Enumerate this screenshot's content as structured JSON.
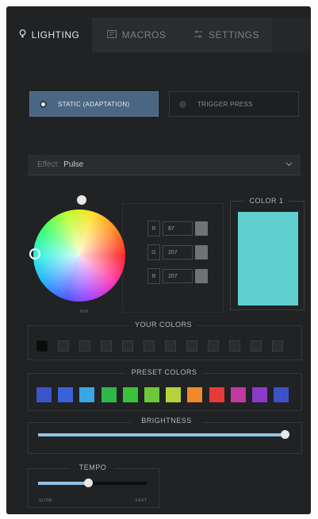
{
  "tabs": [
    {
      "label": "LIGHTING",
      "icon": "lightbulb-icon",
      "active": true
    },
    {
      "label": "MACROS",
      "icon": "macro-icon",
      "active": false
    },
    {
      "label": "SETTINGS",
      "icon": "settings-icon",
      "active": false
    }
  ],
  "mode": {
    "static_label": "STATIC (ADAPTATION)",
    "trigger_label": "TRIGGER PRESS",
    "selected": "static"
  },
  "effect": {
    "label": "Effect:",
    "value": "Pulse"
  },
  "wheel": {
    "caption": "HUE"
  },
  "rgb": [
    {
      "key": "R",
      "value": "87"
    },
    {
      "key": "G",
      "value": "207"
    },
    {
      "key": "B",
      "value": "207"
    }
  ],
  "color1": {
    "title": "COLOR 1",
    "swatch_color": "#5fcfcf"
  },
  "your_colors": {
    "title": "YOUR COLORS",
    "slots": 12,
    "filled_slots": 1
  },
  "preset_colors": {
    "title": "PRESET COLORS",
    "colors": [
      "#3a55c8",
      "#3a62d8",
      "#3aa6e8",
      "#2fb84a",
      "#3ac23a",
      "#6cc83a",
      "#b8d23a",
      "#f08a2a",
      "#e83a3a",
      "#c23aa0",
      "#8a3ac8",
      "#3a52c8"
    ]
  },
  "brightness": {
    "title": "BRIGHTNESS",
    "value_percent": 100
  },
  "tempo": {
    "title": "TEMPO",
    "value_percent": 47,
    "min_label": "SLOW",
    "max_label": "FAST"
  },
  "colors": {
    "accent": "#4a6682",
    "slider_fill": "#8fc4e6",
    "background": "#202224"
  }
}
